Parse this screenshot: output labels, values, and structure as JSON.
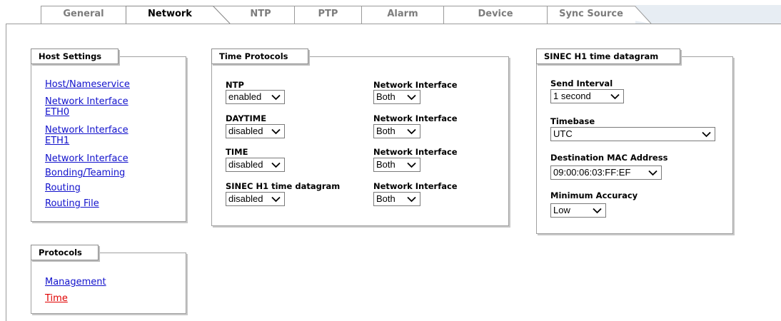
{
  "tabs": [
    {
      "label": "General",
      "active": false
    },
    {
      "label": "Network",
      "active": true
    },
    {
      "label": "NTP",
      "active": false
    },
    {
      "label": "PTP",
      "active": false
    },
    {
      "label": "Alarm",
      "active": false
    },
    {
      "label": "Device",
      "active": false
    },
    {
      "label": "Sync Source",
      "active": false
    }
  ],
  "host_settings": {
    "title": "Host Settings",
    "links": [
      {
        "line1": "Host/Nameservice",
        "line2": ""
      },
      {
        "line1": "Network Interface",
        "line2": "ETH0"
      },
      {
        "line1": "Network Interface",
        "line2": "ETH1"
      },
      {
        "line1": "Network Interface",
        "line2": "Bonding/Teaming"
      },
      {
        "line1": "Routing",
        "line2": ""
      },
      {
        "line1": "Routing File",
        "line2": ""
      }
    ]
  },
  "protocols": {
    "title": "Protocols",
    "links": [
      {
        "label": "Management",
        "current": false
      },
      {
        "label": "Time",
        "current": true
      }
    ]
  },
  "time_protocols": {
    "title": "Time Protocols",
    "rows": [
      {
        "protocol": "NTP",
        "state": "enabled",
        "iface_label": "Network Interface",
        "iface": "Both"
      },
      {
        "protocol": "DAYTIME",
        "state": "disabled",
        "iface_label": "Network Interface",
        "iface": "Both"
      },
      {
        "protocol": "TIME",
        "state": "disabled",
        "iface_label": "Network Interface",
        "iface": "Both"
      },
      {
        "protocol": "SINEC H1 time datagram",
        "state": "disabled",
        "iface_label": "Network Interface",
        "iface": "Both"
      }
    ]
  },
  "sinec": {
    "title": "SINEC H1 time datagram",
    "send_interval_label": "Send Interval",
    "send_interval": "1 second",
    "timebase_label": "Timebase",
    "timebase": "UTC",
    "dest_mac_label": "Destination MAC Address",
    "dest_mac": "09:00:06:03:FF:EF",
    "min_accuracy_label": "Minimum Accuracy",
    "min_accuracy": "Low"
  },
  "colors": {
    "link": "#1212cc",
    "current_link": "#e00000",
    "tab_inactive_text": "#7c7c7c",
    "tabstrip_bg": "#e7edf3"
  },
  "icons": {
    "dropdown": "chevron-down-icon"
  }
}
